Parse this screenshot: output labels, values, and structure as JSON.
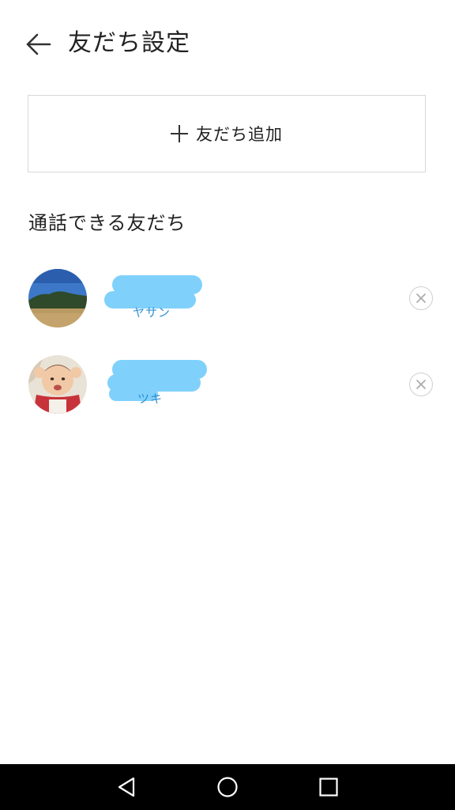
{
  "header": {
    "title": "友だち設定",
    "back_icon": "arrow-left-icon"
  },
  "add_friend": {
    "label": "友だち追加",
    "icon": "plus-icon"
  },
  "section": {
    "title": "通話できる友だち"
  },
  "friends": [
    {
      "subtitle": "ヤサン",
      "remove_icon": "close-circle-icon"
    },
    {
      "subtitle": "ツキ",
      "remove_icon": "close-circle-icon"
    }
  ],
  "navbar": {
    "back_icon": "nav-back-icon",
    "home_icon": "nav-home-icon",
    "recents_icon": "nav-recents-icon"
  },
  "colors": {
    "accent_text": "#2f8fd5",
    "redaction": "#7fd1fb",
    "navbar_bg": "#000000"
  }
}
